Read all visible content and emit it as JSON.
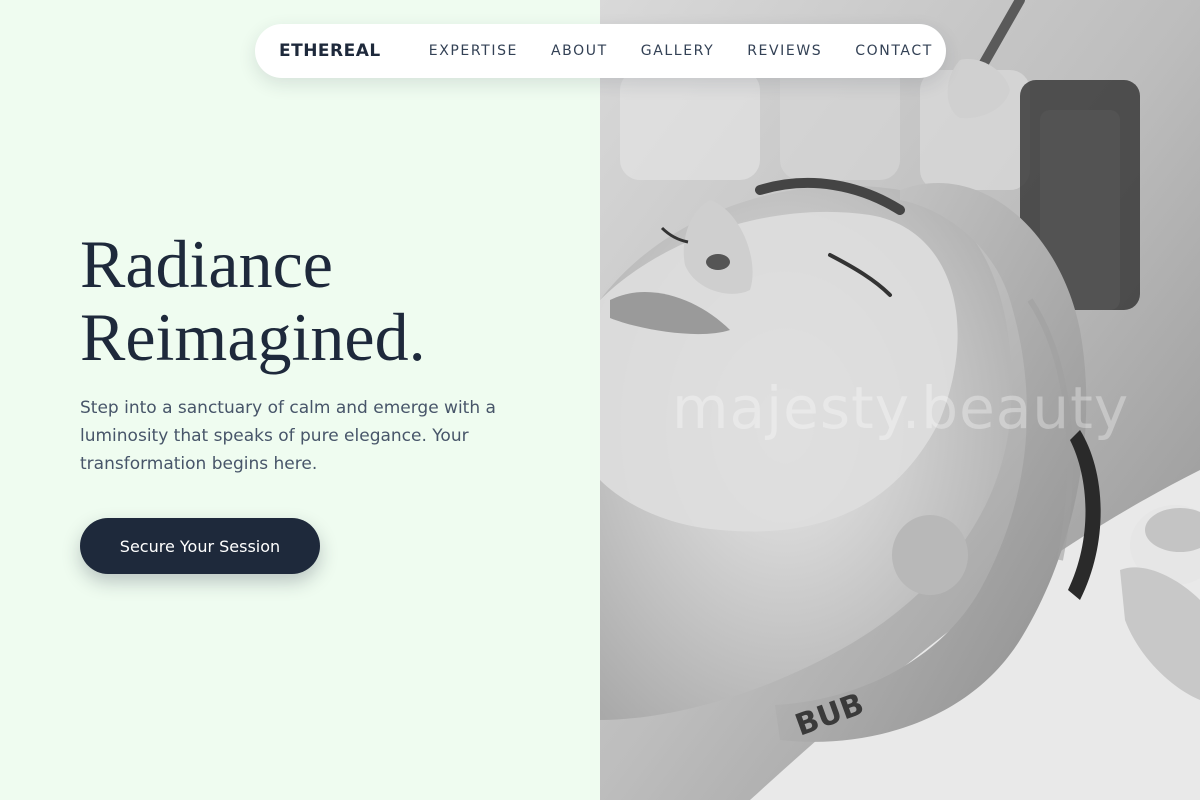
{
  "nav": {
    "brand": "ETHEREAL",
    "links": [
      "EXPERTISE",
      "ABOUT",
      "GALLERY",
      "REVIEWS",
      "CONTACT"
    ]
  },
  "hero": {
    "title_line1": "Radiance",
    "title_line2": "Reimagined.",
    "subtitle": "Step into a sanctuary of calm and emerge with a luminosity that speaks of pure elegance. Your transformation begins here.",
    "cta_label": "Secure Your Session"
  },
  "photo": {
    "watermark": "majesty.beauty"
  },
  "colors": {
    "background": "#effcf0",
    "primary": "#1e293b",
    "text_muted": "#475569"
  }
}
